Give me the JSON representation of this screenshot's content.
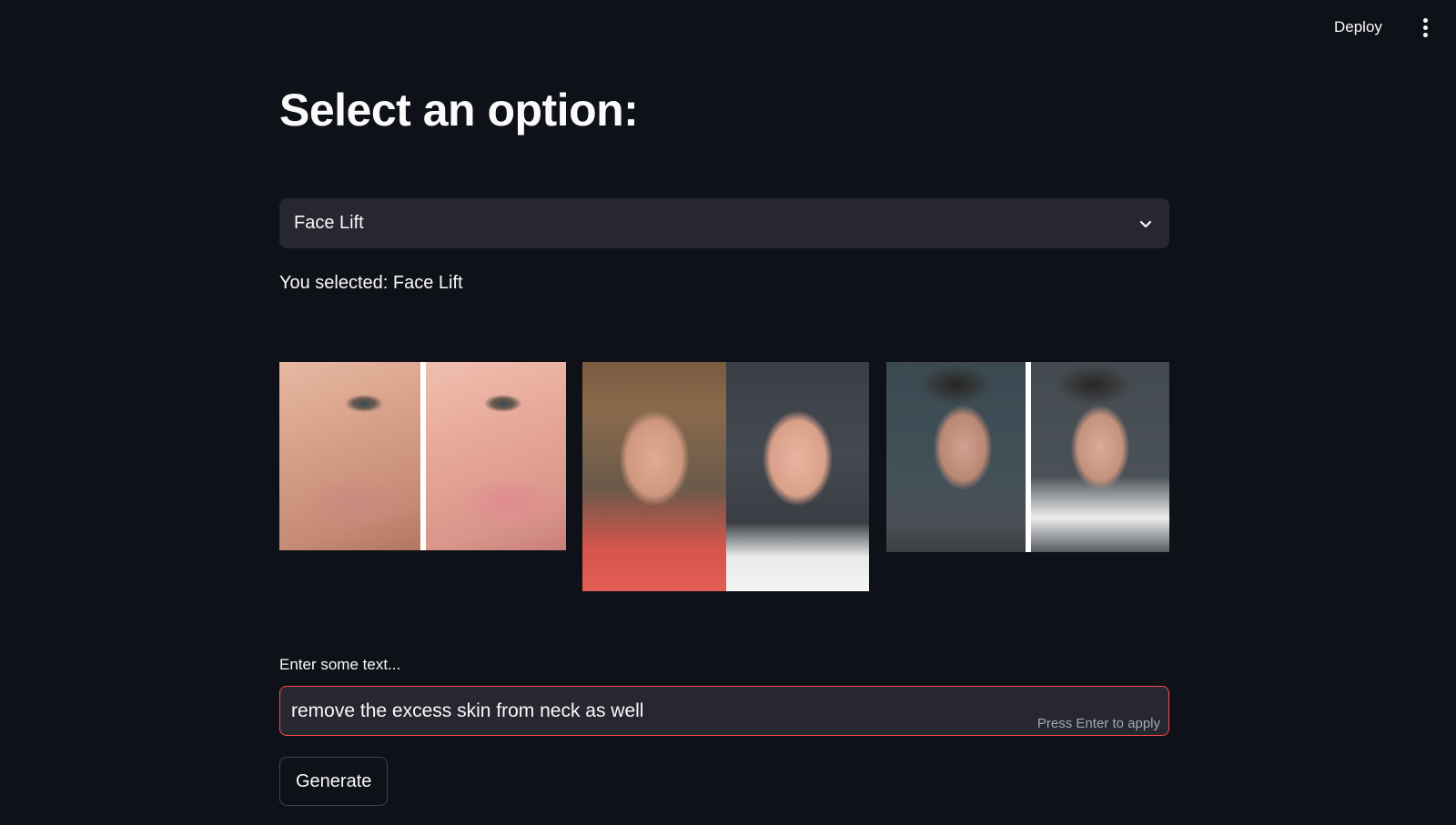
{
  "header": {
    "deploy_label": "Deploy",
    "menu_icon": "kebab-menu-icon"
  },
  "main": {
    "title": "Select an option:",
    "select": {
      "value": "Face Lift",
      "icon": "chevron-down-icon"
    },
    "selected_text": "You selected: Face Lift",
    "gallery": [
      {
        "description": "before-after-eye-closeup"
      },
      {
        "description": "before-after-woman-face"
      },
      {
        "description": "before-after-man-profile"
      }
    ],
    "text_input": {
      "label": "Enter some text...",
      "value": "remove the excess skin from neck as well",
      "hint": "Press Enter to apply",
      "border_color": "#ff4b4b"
    },
    "generate_label": "Generate"
  },
  "colors": {
    "background": "#0e1117",
    "input_bg": "#262730",
    "text": "#fafafa",
    "accent": "#ff4b4b"
  }
}
